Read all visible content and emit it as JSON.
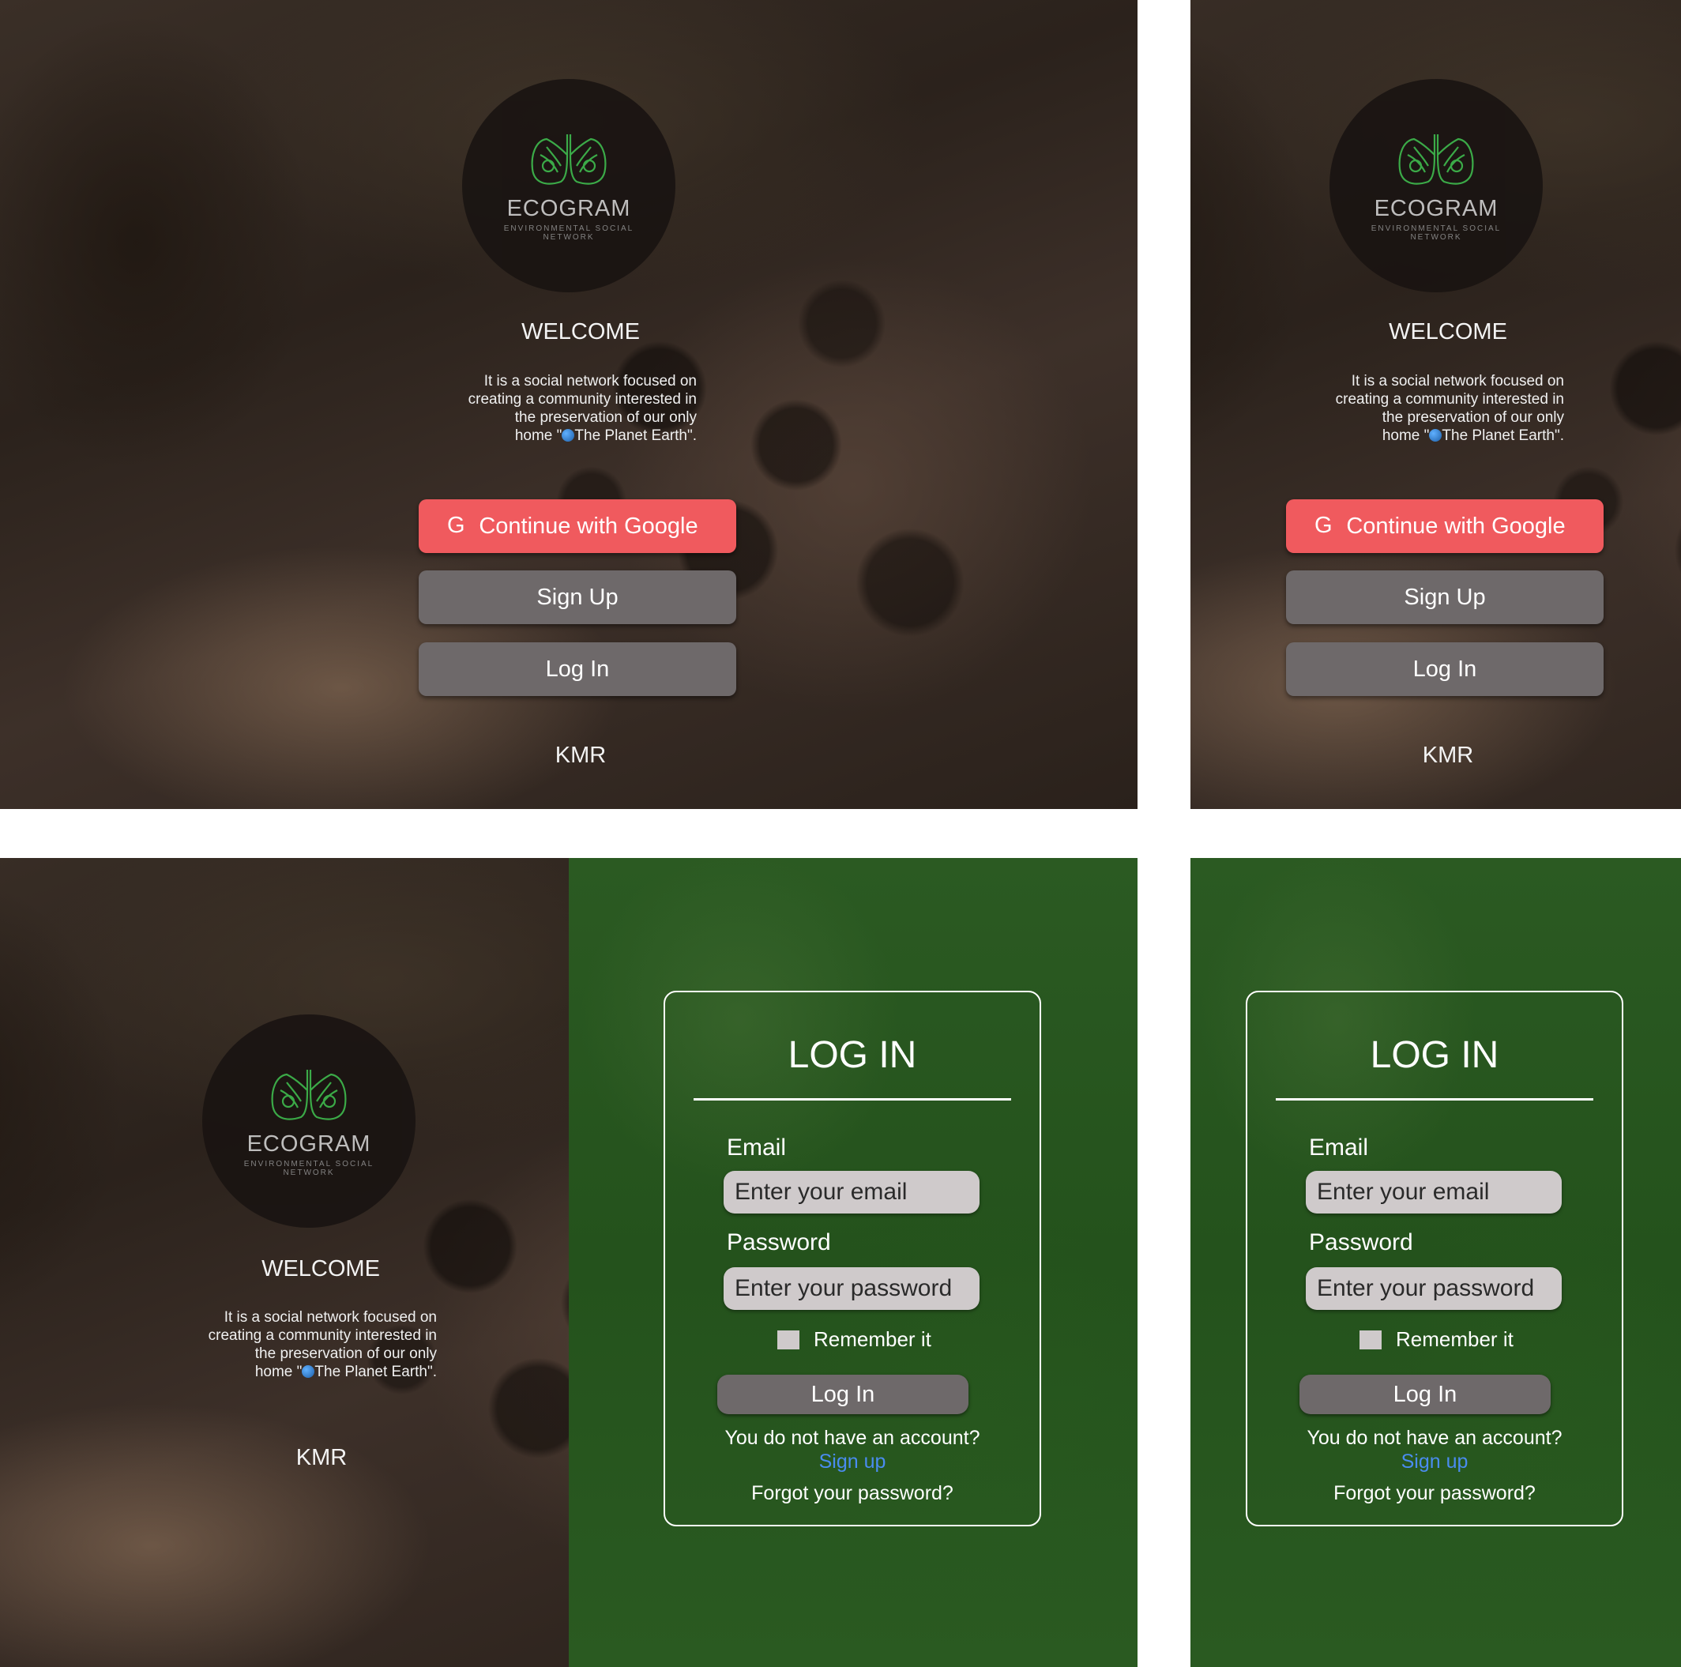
{
  "brand": {
    "name": "ECOGRAM",
    "tagline": "ENVIRONMENTAL SOCIAL NETWORK"
  },
  "welcome": {
    "title": "WELCOME",
    "desc_line1": "It is a social network focused on",
    "desc_line2": "creating a community interested in",
    "desc_line3": "the preservation of our only",
    "desc_line4_pre": "home \"",
    "desc_line4_post": "The Planet Earth\"."
  },
  "buttons": {
    "google_icon": "G",
    "google": "Continue with Google",
    "signup": "Sign Up",
    "login": "Log In"
  },
  "footer": {
    "credit": "KMR"
  },
  "login_form": {
    "title": "LOG IN",
    "email_label": "Email",
    "email_placeholder": "Enter your email",
    "password_label": "Password",
    "password_placeholder": "Enter your password",
    "remember_label": "Remember it",
    "submit": "Log In",
    "no_account": "You do not have an account?",
    "signup_link": "Sign up",
    "forgot": "Forgot your password?"
  },
  "colors": {
    "google_button": "#f05a5e",
    "gray_button": "#6e696a",
    "link": "#4a8cf0",
    "green_bg": "#2a5a21",
    "logo_green": "#3cb44b"
  },
  "icons": {
    "logo": "lungs-leaf-icon",
    "globe": "earth-globe-icon"
  }
}
